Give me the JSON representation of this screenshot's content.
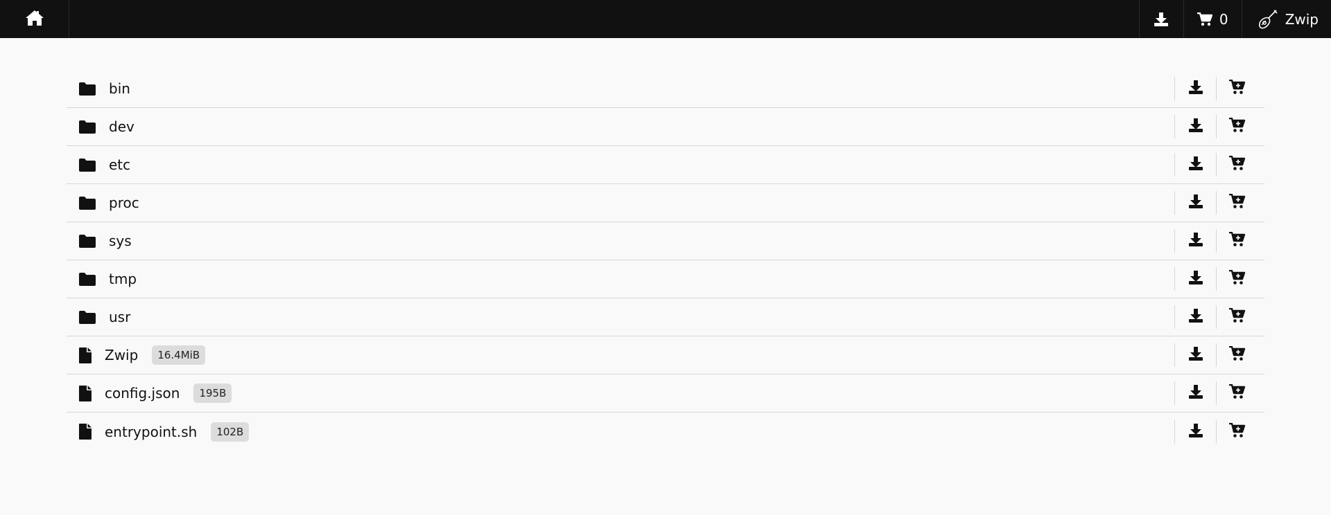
{
  "navbar": {
    "cart_count": "0",
    "brand_label": "Zwip",
    "colors": {
      "background": "#111111",
      "text": "#ffffff"
    }
  },
  "entries": [
    {
      "type": "folder",
      "name": "bin",
      "size": ""
    },
    {
      "type": "folder",
      "name": "dev",
      "size": ""
    },
    {
      "type": "folder",
      "name": "etc",
      "size": ""
    },
    {
      "type": "folder",
      "name": "proc",
      "size": ""
    },
    {
      "type": "folder",
      "name": "sys",
      "size": ""
    },
    {
      "type": "folder",
      "name": "tmp",
      "size": ""
    },
    {
      "type": "folder",
      "name": "usr",
      "size": ""
    },
    {
      "type": "file",
      "name": "Zwip",
      "size": "16.4MiB"
    },
    {
      "type": "file",
      "name": "config.json",
      "size": "195B"
    },
    {
      "type": "file",
      "name": "entrypoint.sh",
      "size": "102B"
    }
  ],
  "icons": {
    "home": "home-icon",
    "download": "download-icon",
    "cart": "cart-icon",
    "cart_add": "cart-add-icon",
    "folder": "folder-icon",
    "file": "file-icon",
    "brand": "lute-icon"
  }
}
